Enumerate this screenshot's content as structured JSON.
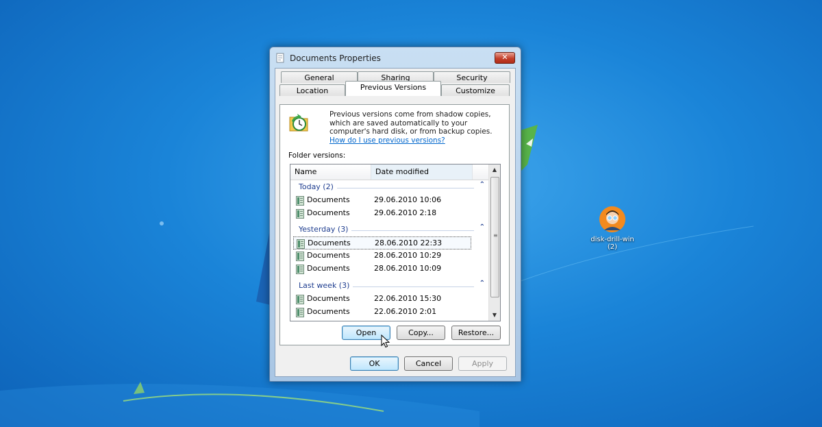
{
  "desktop": {
    "icon_label_line1": "disk-drill-win",
    "icon_label_line2": "(2)"
  },
  "window": {
    "title": "Documents Properties",
    "close_glyph": "✕",
    "tabs_top": [
      "General",
      "Sharing",
      "Security"
    ],
    "tabs_bottom": [
      "Location",
      "Previous Versions",
      "Customize"
    ],
    "active_tab": "Previous Versions"
  },
  "previous_versions": {
    "info_text": "Previous versions come from shadow copies, which are saved automatically to your computer's hard disk, or from backup copies.",
    "help_link": "How do I use previous versions?",
    "folder_versions_label": "Folder versions:",
    "columns": {
      "name": "Name",
      "date": "Date modified"
    },
    "groups": [
      {
        "title": "Today (2)",
        "items": [
          {
            "name": "Documents",
            "date": "29.06.2010 10:06"
          },
          {
            "name": "Documents",
            "date": "29.06.2010 2:18"
          }
        ]
      },
      {
        "title": "Yesterday (3)",
        "items": [
          {
            "name": "Documents",
            "date": "28.06.2010 22:33"
          },
          {
            "name": "Documents",
            "date": "28.06.2010 10:29"
          },
          {
            "name": "Documents",
            "date": "28.06.2010 10:09"
          }
        ]
      },
      {
        "title": "Last week (3)",
        "items": [
          {
            "name": "Documents",
            "date": "22.06.2010 15:30"
          },
          {
            "name": "Documents",
            "date": "22.06.2010 2:01"
          }
        ]
      }
    ],
    "selected_item_date": "28.06.2010 22:33",
    "buttons": {
      "open": "Open",
      "copy": "Copy...",
      "restore": "Restore..."
    }
  },
  "dialog_buttons": {
    "ok": "OK",
    "cancel": "Cancel",
    "apply": "Apply"
  },
  "icons": {
    "title": "folder-properties-icon",
    "info": "previous-versions-clock-icon",
    "row": "document-folder-icon",
    "collapse": "chevron-up-icon"
  }
}
